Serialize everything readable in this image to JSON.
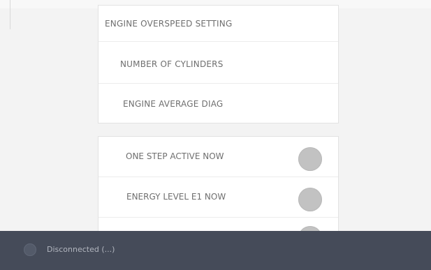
{
  "settings": {
    "upper_rows": [
      {
        "label": "ENGINE OVERSPEED SETTING"
      },
      {
        "label": "NUMBER OF CYLINDERS"
      },
      {
        "label": "ENGINE AVERAGE DIAG"
      }
    ],
    "toggle_rows": [
      {
        "label": "ONE STEP ACTIVE NOW",
        "state": "off",
        "icon": "toggle-indicator"
      },
      {
        "label": "ENERGY LEVEL E1 NOW",
        "state": "off",
        "icon": "toggle-indicator"
      },
      {
        "label": "",
        "state": "off",
        "icon": "toggle-indicator"
      }
    ]
  },
  "status_bar": {
    "text": "Disconnected (...)",
    "icon": "connection-status-icon"
  },
  "colors": {
    "background": "#f3f3f3",
    "panel": "#ffffff",
    "text": "#6f6f6f",
    "toggle_off": "#c2c2c2",
    "status_bar": "#454b59"
  }
}
